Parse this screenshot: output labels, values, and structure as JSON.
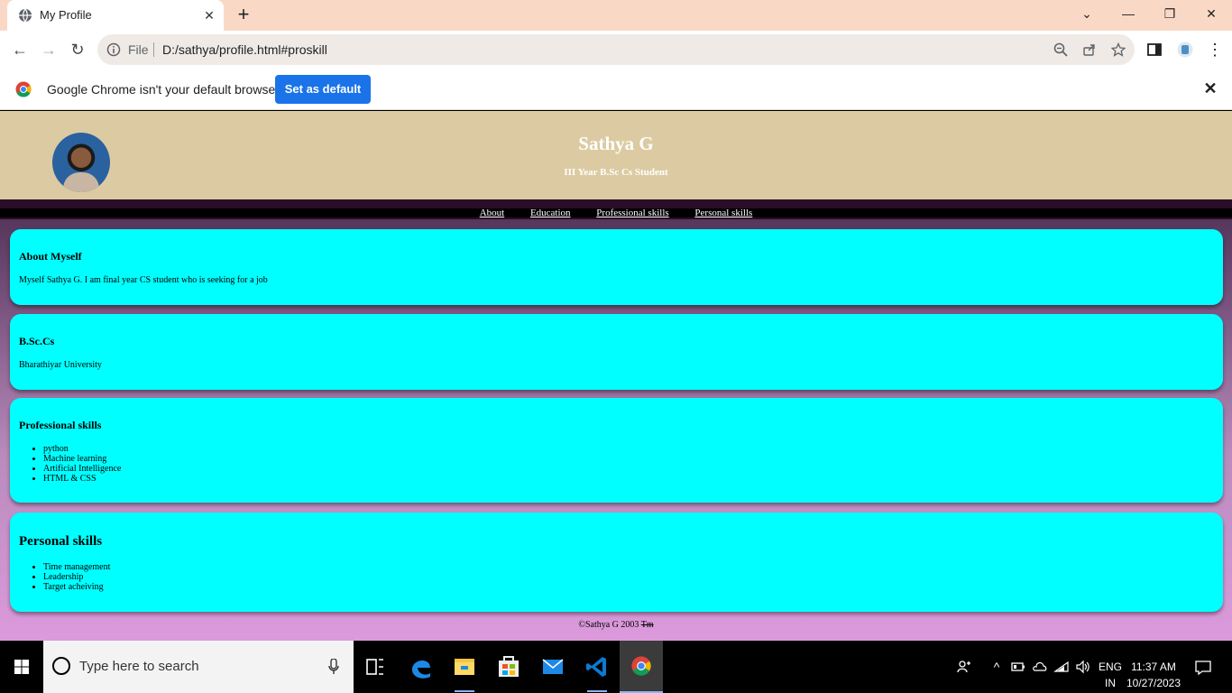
{
  "browser": {
    "tab_title": "My Profile",
    "url_scheme": "File",
    "url": "D:/sathya/profile.html#proskill",
    "infobar_message": "Google Chrome isn't your default browser",
    "infobar_button": "Set as default"
  },
  "profile": {
    "name": "Sathya G",
    "subtitle": "III Year B.Sc Cs Student",
    "nav": [
      "About",
      "Education",
      "Professional skills",
      "Personal skills"
    ]
  },
  "sections": {
    "about": {
      "heading": "About Myself",
      "text": "Myself Sathya G. I am final year CS student who is seeking for a job"
    },
    "education": {
      "heading": "B.Sc.Cs",
      "text": "Bharathiyar University"
    },
    "professional": {
      "heading": "Professional skills",
      "items": [
        "python",
        "Machine learning",
        "Artificial Intelligence",
        "HTML & CSS"
      ]
    },
    "personal": {
      "heading": "Personal skills",
      "items": [
        "Time management",
        "Leadership",
        "Target acheiving"
      ]
    }
  },
  "footer": {
    "copyright": "©Sathya G 2003",
    "tm": "Tm"
  },
  "taskbar": {
    "search_placeholder": "Type here to search",
    "lang_line1": "ENG",
    "lang_line2": "IN",
    "time": "11:37 AM",
    "date": "10/27/2023"
  },
  "colors": {
    "card_bg": "#00ffff",
    "header_bg": "#dccba2",
    "accent_blue": "#1a73e8"
  }
}
